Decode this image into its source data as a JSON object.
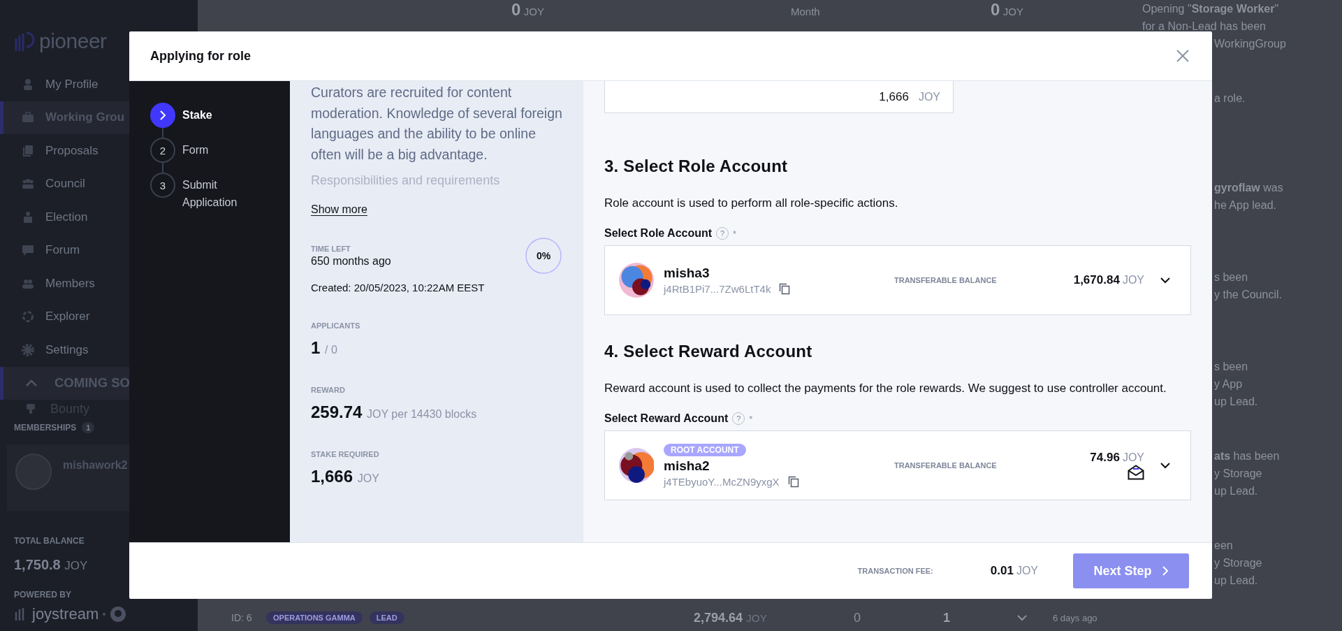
{
  "sidebar": {
    "logo": "pioneer",
    "nav": [
      {
        "label": "My Profile",
        "selected": false
      },
      {
        "label": "Working Grou",
        "selected": true
      },
      {
        "label": "Proposals",
        "selected": false
      },
      {
        "label": "Council",
        "selected": false
      },
      {
        "label": "Election",
        "selected": false
      },
      {
        "label": "Forum",
        "selected": false
      },
      {
        "label": "Members",
        "selected": false
      },
      {
        "label": "Explorer",
        "selected": false
      },
      {
        "label": "Settings",
        "selected": false
      }
    ],
    "section": {
      "label": "COMING SO",
      "expanded": true,
      "items": [
        {
          "label": "Bounty"
        }
      ]
    },
    "memberships": {
      "label": "MEMBERSHIPS",
      "count": "1",
      "member": "mishawork2"
    },
    "balance": {
      "label": "TOTAL BALANCE",
      "value": "1,750.8",
      "unit": "JOY"
    },
    "powered_by": {
      "label": "POWERED BY",
      "brand": "joystream"
    }
  },
  "background": {
    "stats": [
      {
        "kind": "amount",
        "value": "0",
        "unit": "JOY"
      },
      {
        "kind": "label",
        "label": "Month"
      },
      {
        "kind": "amount",
        "value": "0",
        "unit": "JOY"
      }
    ],
    "notifications": [
      {
        "lines": [
          {
            "text": "Opening \"**Storage Worker**\"",
            "cut": false
          },
          {
            "text": "for a Non-Lead has been",
            "cut": false
          },
          {
            "text": "WorkingGroup",
            "cut": true
          }
        ]
      },
      {
        "lines": [
          {
            "text": "a role.",
            "cut": true
          }
        ]
      },
      {
        "lines": [
          {
            "text": "**gyroflaw** was",
            "cut": true
          },
          {
            "text": "he App lead.",
            "cut": true
          }
        ]
      },
      {
        "lines": [
          {
            "text": "s been",
            "cut": true
          },
          {
            "text": "y the Council.",
            "cut": true
          }
        ]
      },
      {
        "lines": [
          {
            "text": "s been",
            "cut": true
          },
          {
            "text": "y App",
            "cut": true
          },
          {
            "text": "up Lead.",
            "cut": true
          }
        ]
      },
      {
        "lines": [
          {
            "text": "**ats** has been",
            "cut": true
          },
          {
            "text": "y Storage",
            "cut": true
          },
          {
            "text": "up Lead.",
            "cut": true
          }
        ]
      },
      {
        "lines": [
          {
            "text": "een",
            "cut": true
          },
          {
            "text": "y Storage",
            "cut": true
          },
          {
            "text": "up Lead.",
            "cut": true
          }
        ]
      }
    ],
    "row": {
      "id": "ID: 6",
      "tags": [
        "OPERATIONS GAMMA",
        "LEAD"
      ],
      "amount": "2,794.64",
      "unit": "JOY",
      "column_3": "0",
      "column_4": "1"
    },
    "time": "6 days ago"
  },
  "modal": {
    "title": "Applying for role",
    "steps": [
      {
        "label": "Stake",
        "selected": true
      },
      {
        "number": "2",
        "label": "Form",
        "selected": false
      },
      {
        "number": "3",
        "label": "Submit Application",
        "selected": false
      }
    ],
    "opening": {
      "description": "Curators are recruited for content moderation. Knowledge of several foreign languages and the ability to be online often will be a big advantage.",
      "next_heading": "Responsibilities and requirements",
      "show_more": "Show more",
      "time_left": {
        "label": "TIME LEFT",
        "value": "650 months ago",
        "progress": "0%",
        "level": 0
      },
      "created": "Created: 20/05/2023, 10:22AM EEST",
      "applicants": {
        "label": "APPLICANTS",
        "value": "1",
        "total": "/ 0"
      },
      "reward": {
        "label": "REWARD",
        "value": "259.74",
        "unit": "JOY per 14430 blocks"
      },
      "stake": {
        "label": "STAKE REQUIRED",
        "value": "1,666",
        "unit": "JOY"
      }
    },
    "stake_input": {
      "value": "1,666",
      "unit": "JOY"
    },
    "sections": [
      {
        "heading": "3. Select Role Account",
        "description": "Role account is used to perform all role-specific actions.",
        "field_label": "Select Role Account",
        "help": "?",
        "required": "*",
        "account": {
          "name": "misha3",
          "address": "j4RtB1Pi7...7Zw6LtT4k",
          "balance_label": "TRANSFERABLE BALANCE",
          "balance": "1,670.84",
          "unit": "JOY",
          "envelope": false
        }
      },
      {
        "heading": "4. Select Reward Account",
        "description": "Reward account is used to collect the payments for the role rewards. We suggest to use controller account.",
        "field_label": "Select Reward Account",
        "help": "?",
        "required": "*",
        "account": {
          "badge": "ROOT ACCOUNT",
          "name": "misha2",
          "address": "j4TEbyuoY...McZN9yxgX",
          "balance_label": "TRANSFERABLE BALANCE",
          "balance": "74.96",
          "unit": "JOY",
          "envelope": true
        }
      }
    ],
    "footer": {
      "fee_label": "TRANSACTION FEE:",
      "fee": "0.01",
      "unit": "JOY",
      "next": {
        "label": "Next Step",
        "disabled": true
      }
    }
  }
}
